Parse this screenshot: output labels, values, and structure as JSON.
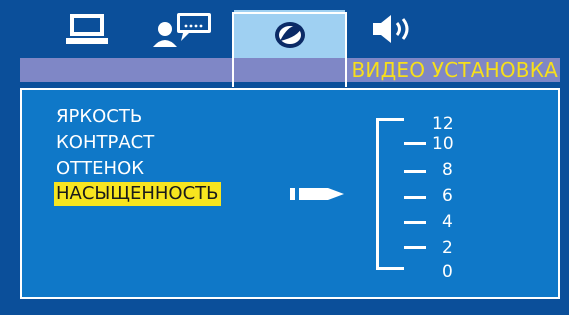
{
  "tabs": [
    {
      "icon": "computer-icon",
      "active": false
    },
    {
      "icon": "person-chat-icon",
      "active": false
    },
    {
      "icon": "picture-circle-icon",
      "active": true
    },
    {
      "icon": "speaker-icon",
      "active": false
    }
  ],
  "header": {
    "title": "ВИДЕО УСТАНОВКА"
  },
  "menu": {
    "items": [
      {
        "label": "ЯРКОСТЬ",
        "selected": false
      },
      {
        "label": "КОНТРАСТ",
        "selected": false
      },
      {
        "label": "ОТТЕНОК",
        "selected": false
      },
      {
        "label": "НАСЫЩЕННОСТЬ",
        "selected": true
      }
    ]
  },
  "scale": {
    "labels": [
      "12",
      "10",
      "8",
      "6",
      "4",
      "2",
      "0"
    ]
  },
  "colors": {
    "background": "#0b4f9a",
    "panel": "#0f78c8",
    "title_bar": "#7f87c6",
    "accent": "#f7e51f",
    "active_tab": "#9fd0f2"
  }
}
